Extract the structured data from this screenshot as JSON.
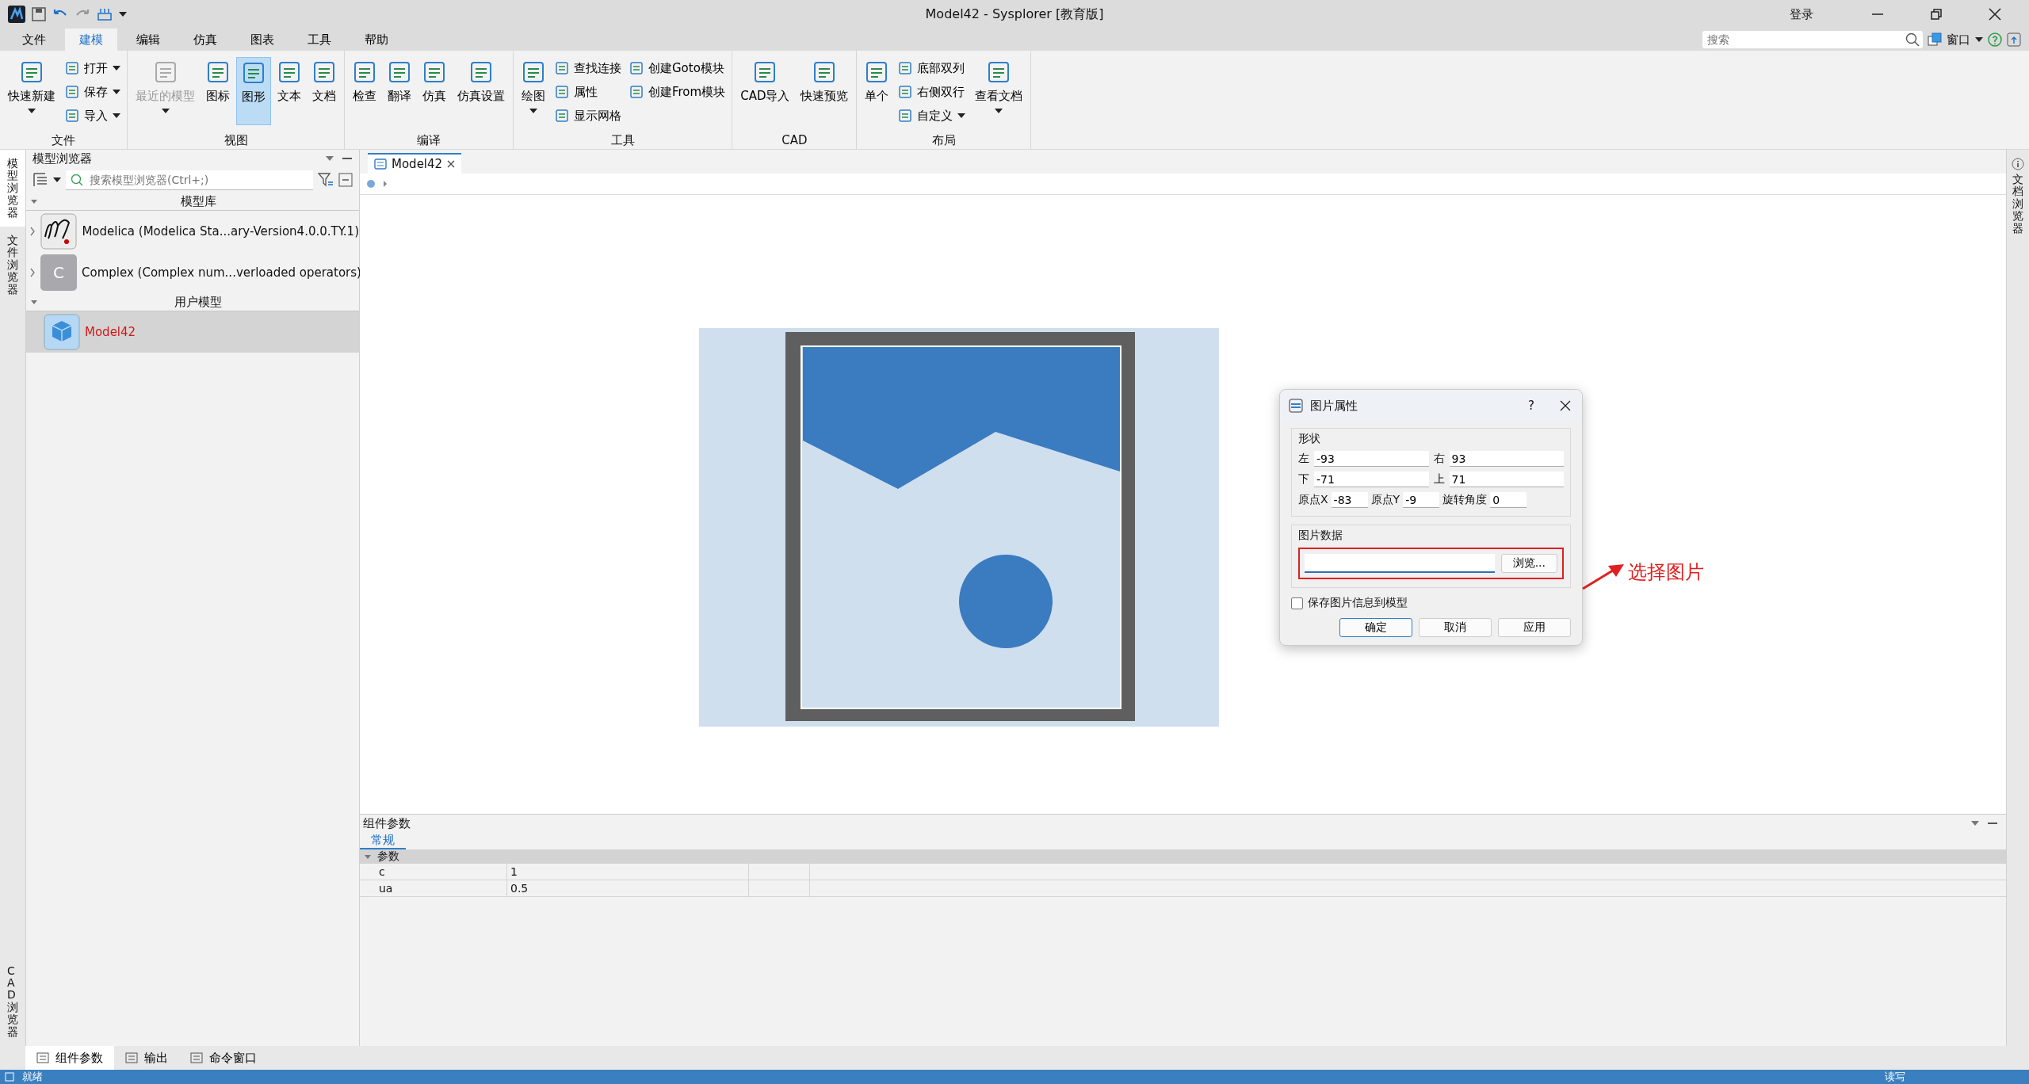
{
  "window": {
    "title": "Model42 - Sysplorer [教育版]",
    "login": "登录"
  },
  "menu_tabs": [
    {
      "label": "文件",
      "selected": false
    },
    {
      "label": "建模",
      "selected": true
    },
    {
      "label": "编辑",
      "selected": false
    },
    {
      "label": "仿真",
      "selected": false
    },
    {
      "label": "图表",
      "selected": false
    },
    {
      "label": "工具",
      "selected": false
    },
    {
      "label": "帮助",
      "selected": false
    }
  ],
  "search": {
    "placeholder": "搜索"
  },
  "window_menu": "窗口",
  "ribbon": [
    {
      "name": "文件",
      "items": [
        {
          "kind": "large",
          "label": "快速新建",
          "caret": true,
          "selected": false,
          "disabled": false
        },
        {
          "kind": "stack",
          "items": [
            {
              "label": "打开",
              "caret": true
            },
            {
              "label": "保存",
              "caret": true
            },
            {
              "label": "导入",
              "caret": true
            }
          ]
        }
      ]
    },
    {
      "name": "视图",
      "items": [
        {
          "kind": "large",
          "label": "最近的模型",
          "caret": true,
          "selected": false,
          "disabled": true
        },
        {
          "kind": "large",
          "label": "图标",
          "caret": false,
          "selected": false,
          "disabled": false
        },
        {
          "kind": "large",
          "label": "图形",
          "caret": false,
          "selected": true,
          "disabled": false
        },
        {
          "kind": "large",
          "label": "文本",
          "caret": false,
          "selected": false,
          "disabled": false
        },
        {
          "kind": "large",
          "label": "文档",
          "caret": false,
          "selected": false,
          "disabled": false
        }
      ]
    },
    {
      "name": "编译",
      "items": [
        {
          "kind": "large",
          "label": "检查",
          "caret": false,
          "selected": false,
          "disabled": false
        },
        {
          "kind": "large",
          "label": "翻译",
          "caret": false,
          "selected": false,
          "disabled": false
        },
        {
          "kind": "large",
          "label": "仿真",
          "caret": false,
          "selected": false,
          "disabled": false
        },
        {
          "kind": "large",
          "label": "仿真设置",
          "caret": false,
          "selected": false,
          "disabled": false
        }
      ]
    },
    {
      "name": "工具",
      "items": [
        {
          "kind": "large",
          "label": "绘图",
          "caret": true,
          "selected": false,
          "disabled": false
        },
        {
          "kind": "stack",
          "items": [
            {
              "label": "查找连接",
              "caret": false
            },
            {
              "label": "属性",
              "caret": false
            },
            {
              "label": "显示网格",
              "caret": false
            }
          ]
        },
        {
          "kind": "stack",
          "items": [
            {
              "label": "创建Goto模块",
              "caret": false
            },
            {
              "label": "创建From模块",
              "caret": false
            }
          ]
        }
      ]
    },
    {
      "name": "CAD",
      "items": [
        {
          "kind": "large",
          "label": "CAD导入",
          "caret": false,
          "selected": false,
          "disabled": false
        },
        {
          "kind": "large",
          "label": "快速预览",
          "caret": false,
          "selected": false,
          "disabled": false
        }
      ]
    },
    {
      "name": "布局",
      "items": [
        {
          "kind": "large",
          "label": "单个",
          "caret": false,
          "selected": false,
          "disabled": false
        },
        {
          "kind": "stack",
          "items": [
            {
              "label": "底部双列",
              "caret": false
            },
            {
              "label": "右侧双行",
              "caret": false
            },
            {
              "label": "自定义",
              "caret": true
            }
          ]
        },
        {
          "kind": "large",
          "label": "查看文档",
          "caret": true,
          "selected": false,
          "disabled": false
        }
      ]
    }
  ],
  "side_tabs_left": [
    {
      "label": "模型浏览器",
      "selected": true
    },
    {
      "label": "文件浏览器",
      "selected": false
    },
    {
      "label": "CAD 浏览器",
      "selected": false
    }
  ],
  "side_tabs_right": [
    {
      "label": "文档浏览器",
      "selected": false
    }
  ],
  "model_browser": {
    "title": "模型浏览器",
    "search_placeholder": "搜索模型浏览器(Ctrl+;)",
    "sections": [
      {
        "label": "模型库",
        "expanded": true,
        "items": [
          {
            "label": "Modelica (Modelica Sta...ary-Version4.0.0.TY.1)",
            "kind": "logo",
            "expanded": false,
            "selected": false
          },
          {
            "label": "Complex (Complex num...verloaded operators)",
            "kind": "letter",
            "badge": "C",
            "expanded": false,
            "selected": false
          }
        ]
      },
      {
        "label": "用户模型",
        "expanded": true,
        "items": [
          {
            "label": "Model42",
            "kind": "model",
            "selected": true
          }
        ]
      }
    ]
  },
  "doc_tabs": [
    {
      "label": "Model42",
      "selected": true
    }
  ],
  "dialog": {
    "title": "图片属性",
    "help": "?",
    "shape_group": "形状",
    "fields": [
      {
        "label": "左",
        "value": "-93"
      },
      {
        "label": "右",
        "value": "93"
      },
      {
        "label": "下",
        "value": "-71"
      },
      {
        "label": "上",
        "value": "71"
      }
    ],
    "origin_fields": [
      {
        "label": "原点X",
        "value": "-83"
      },
      {
        "label": "原点Y",
        "value": "-9"
      },
      {
        "label": "旋转角度",
        "value": "0"
      }
    ],
    "image_group": "图片数据",
    "browse": "浏览...",
    "save_checkbox": {
      "label": "保存图片信息到模型",
      "checked": false
    },
    "buttons": [
      {
        "label": "确定",
        "default": true
      },
      {
        "label": "取消",
        "default": false
      },
      {
        "label": "应用",
        "default": false
      }
    ]
  },
  "annotation": {
    "text": "选择图片"
  },
  "params": {
    "title": "组件参数",
    "tabs": [
      {
        "label": "常规",
        "selected": true
      }
    ],
    "group": {
      "label": "参数",
      "expanded": true
    },
    "rows": [
      {
        "name": "c",
        "value": "1"
      },
      {
        "name": "ua",
        "value": "0.5"
      }
    ]
  },
  "bottom_tabs": [
    {
      "label": "组件参数",
      "selected": true
    },
    {
      "label": "输出",
      "selected": false
    },
    {
      "label": "命令窗口",
      "selected": false
    }
  ],
  "status": {
    "left": "就绪",
    "right": "读写"
  }
}
